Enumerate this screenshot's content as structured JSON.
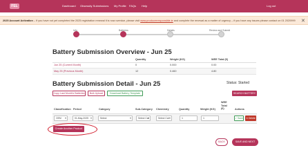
{
  "nav": {
    "logo": "FEL",
    "links": [
      "Dashboard",
      "Obsessity Submissions",
      "My Profile",
      "FAQs",
      "Help"
    ],
    "logout": "Log out"
  },
  "alert": {
    "title": "2025 Account Activation",
    "message": " – If you have not yet completed the 2025 registration renewal it is now overdue, please visit ",
    "link": "www.producerresponsible.ie",
    "message_end": " and complete the renewal as a matter of urgency – if you have any issues please contact on 01 2020999",
    "close": "✕"
  },
  "stepper": {
    "steps": [
      {
        "label": "Info",
        "active": true
      },
      {
        "label": "Batteries",
        "active": true
      },
      {
        "label": "Details",
        "active": false
      },
      {
        "label": "Review and Submit",
        "active": false
      }
    ]
  },
  "overview": {
    "title": "Battery Submission Overview - Jun 25",
    "columns": [
      "",
      "Quantity",
      "Weight (KG)",
      "WEE Total (€)"
    ],
    "rows": [
      {
        "label": "Jun 25 (Current Month)",
        "quantity": "0",
        "weight": "0.000",
        "total": "0.00"
      },
      {
        "label": "May 25 (Previous Month)",
        "quantity": "12",
        "weight": "0.460",
        "total": "4.80"
      }
    ]
  },
  "detail": {
    "title": "Battery Submission Detail - Jun 25",
    "status": "Status: Started",
    "search_button": "SEARCH BATTERY",
    "buttons": {
      "copy": "Copy Last Month's Batteries",
      "bulk": "Bulk Upload",
      "download": "Download Battery Template"
    },
    "columns": {
      "classification": "Classification",
      "period": "Period",
      "category": "Category",
      "sub_category": "Sub-Category",
      "chemistry": "Chemistry",
      "quantity": "Quantity",
      "weight": "Weight (KG)",
      "wee_total_1": "WEE",
      "wee_total_2": "Total",
      "wee_total_3": "(€)",
      "actions": "Actions"
    },
    "row": {
      "classification": "OEM",
      "period": "01-May-2025",
      "category": "Select",
      "sub_category": "Select Cat",
      "chemistry": "Select Cat",
      "quantity": "1",
      "weight": "1",
      "save": "✓ Save",
      "delete": "✕ Delete"
    },
    "create_button": "Create Another Product"
  },
  "footer": {
    "back": "BACK",
    "next": "SAVE AND NEXT"
  },
  "colors": {
    "brand": "#b5345a",
    "alert_bg": "#fbe9d9",
    "success": "#3e9a55",
    "danger": "#c0392b",
    "highlight": "#d11b2b"
  }
}
